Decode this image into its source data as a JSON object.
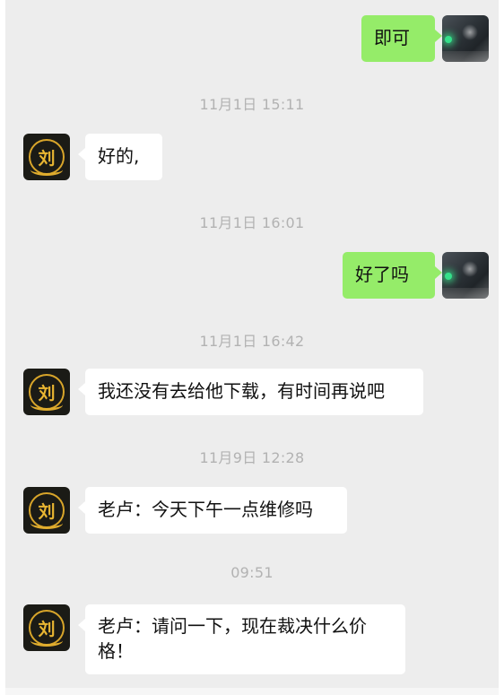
{
  "messages": [
    {
      "side": "out",
      "text": "即可"
    },
    {
      "timestamp": "11月1日 15:11"
    },
    {
      "side": "in",
      "text": "好的,"
    },
    {
      "timestamp": "11月1日 16:01"
    },
    {
      "side": "out",
      "text": "好了吗"
    },
    {
      "timestamp": "11月1日 16:42"
    },
    {
      "side": "in",
      "text": "我还没有去给他下载，有时间再说吧"
    },
    {
      "timestamp": "11月9日 12:28"
    },
    {
      "side": "in",
      "text": "老卢：今天下午一点维修吗"
    },
    {
      "timestamp": "09:51"
    },
    {
      "side": "in",
      "text_line1": "老卢：请问一下，现在裁决什么价",
      "text_line2": "格！"
    }
  ],
  "contact_avatar": {
    "icon": "brand-logo-avatar",
    "logo_char": "刘",
    "colors": {
      "background": "#1b1b16",
      "gold": "#e0ad2e"
    }
  },
  "self_avatar": {
    "icon": "night-street-photo-avatar"
  },
  "colors": {
    "chat_background": "#ededed",
    "incoming_bubble": "#ffffff",
    "outgoing_bubble": "#95ec69",
    "timestamp_text": "#b2b2b2"
  }
}
